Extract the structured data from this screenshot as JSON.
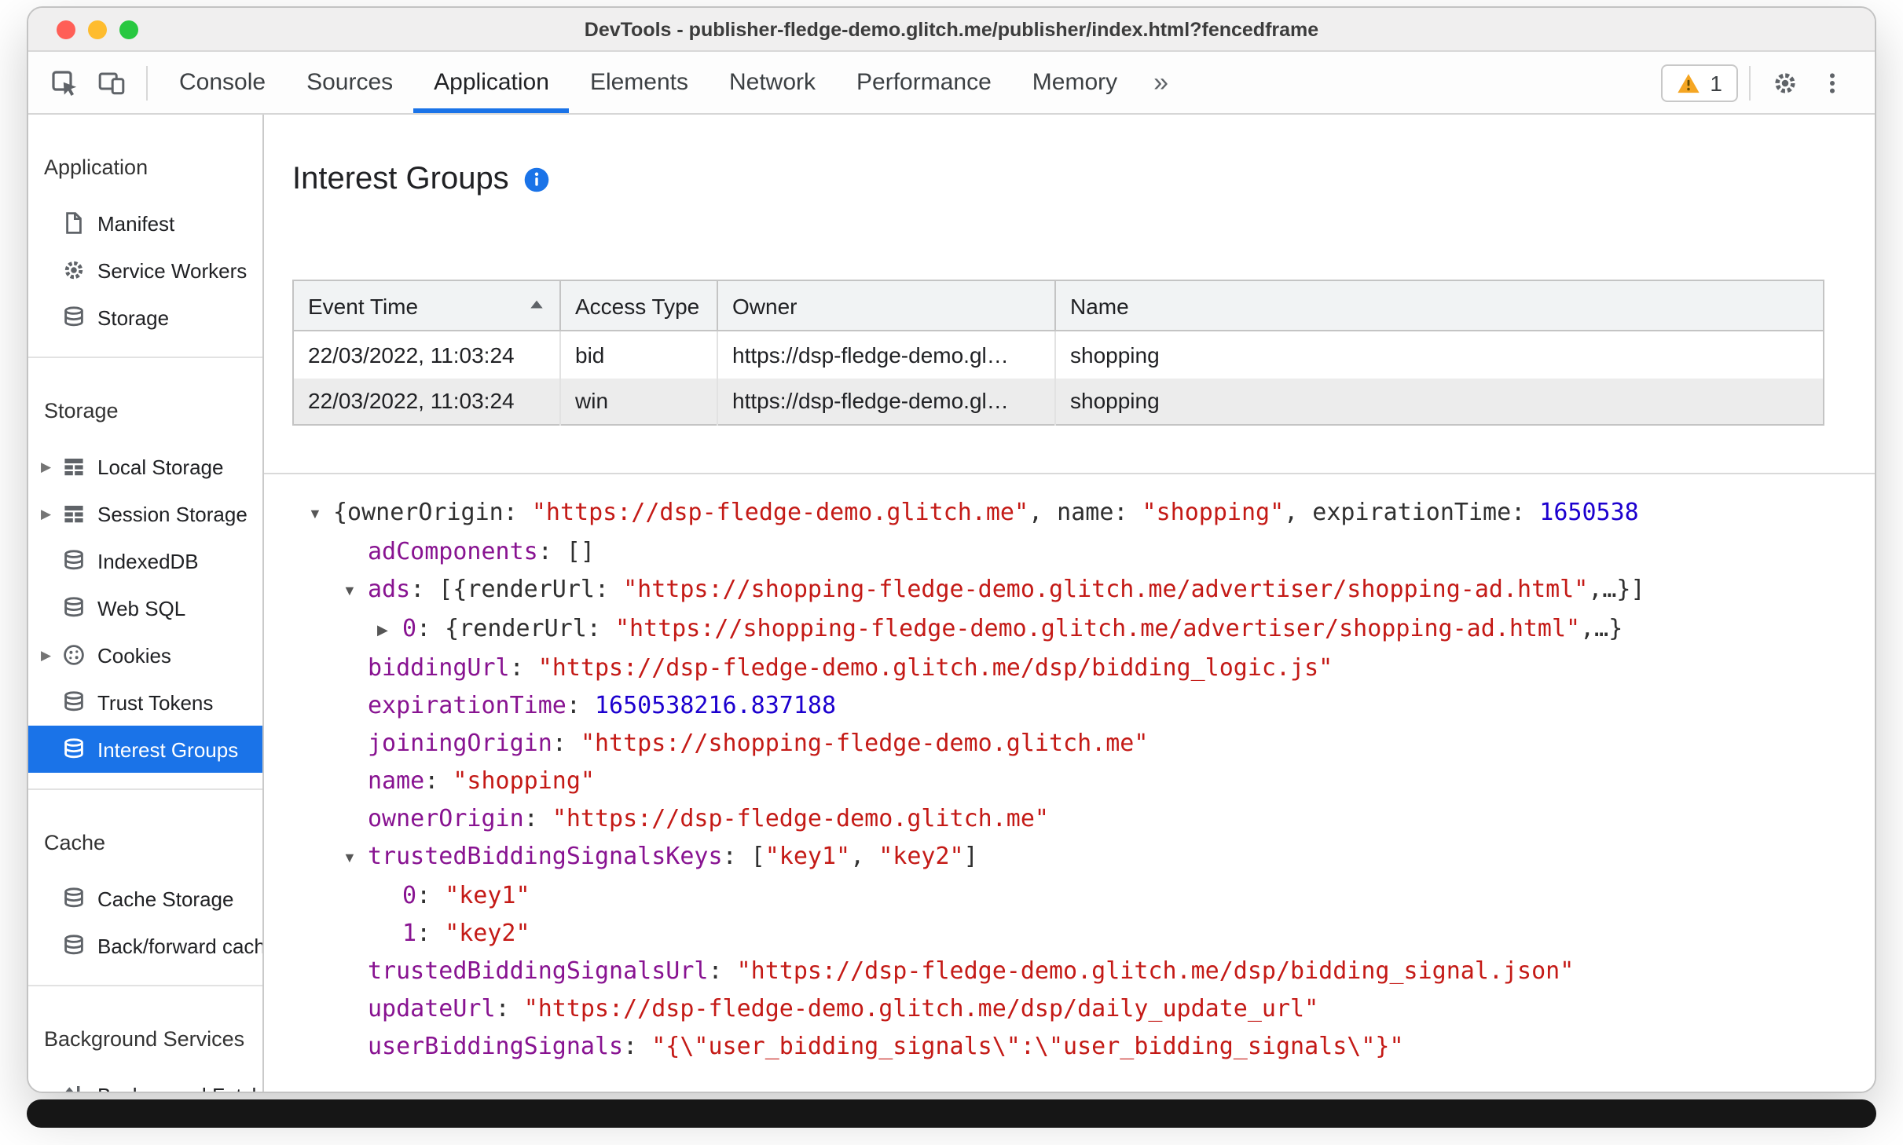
{
  "window": {
    "title": "DevTools - publisher-fledge-demo.glitch.me/publisher/index.html?fencedframe"
  },
  "toolbar": {
    "tabs": [
      {
        "label": "Console",
        "selected": false
      },
      {
        "label": "Sources",
        "selected": false
      },
      {
        "label": "Application",
        "selected": true
      },
      {
        "label": "Elements",
        "selected": false
      },
      {
        "label": "Network",
        "selected": false
      },
      {
        "label": "Performance",
        "selected": false
      },
      {
        "label": "Memory",
        "selected": false
      }
    ],
    "more_tabs_symbol": "»",
    "warning_count": "1"
  },
  "sidebar": {
    "sections": [
      {
        "title": "Application",
        "items": [
          {
            "label": "Manifest",
            "icon": "manifest-file-icon"
          },
          {
            "label": "Service Workers",
            "icon": "service-worker-gear-icon"
          },
          {
            "label": "Storage",
            "icon": "database-icon"
          }
        ]
      },
      {
        "title": "Storage",
        "items": [
          {
            "label": "Local Storage",
            "icon": "table-icon",
            "expandable": true
          },
          {
            "label": "Session Storage",
            "icon": "table-icon",
            "expandable": true
          },
          {
            "label": "IndexedDB",
            "icon": "database-icon"
          },
          {
            "label": "Web SQL",
            "icon": "database-icon"
          },
          {
            "label": "Cookies",
            "icon": "cookie-icon",
            "expandable": true
          },
          {
            "label": "Trust Tokens",
            "icon": "database-icon"
          },
          {
            "label": "Interest Groups",
            "icon": "database-icon",
            "selected": true
          }
        ]
      },
      {
        "title": "Cache",
        "items": [
          {
            "label": "Cache Storage",
            "icon": "database-icon"
          },
          {
            "label": "Back/forward cach",
            "icon": "database-icon"
          }
        ]
      },
      {
        "title": "Background Services",
        "items": [
          {
            "label": "Background Fetch",
            "icon": "background-fetch-icon"
          }
        ]
      }
    ]
  },
  "main": {
    "title": "Interest Groups",
    "table": {
      "columns": [
        "Event Time",
        "Access Type",
        "Owner",
        "Name"
      ],
      "sorted_column": "Event Time",
      "rows": [
        [
          "22/03/2022, 11:03:24",
          "bid",
          "https://dsp-fledge-demo.gl…",
          "shopping"
        ],
        [
          "22/03/2022, 11:03:24",
          "win",
          "https://dsp-fledge-demo.gl…",
          "shopping"
        ]
      ]
    },
    "tree": {
      "lines": [
        {
          "indent": 0,
          "arrow": "down",
          "segments": [
            {
              "t": "{ownerOrigin: ",
              "c": "plain"
            },
            {
              "t": "\"https://dsp-fledge-demo.glitch.me\"",
              "c": "string"
            },
            {
              "t": ", name: ",
              "c": "plain"
            },
            {
              "t": "\"shopping\"",
              "c": "string"
            },
            {
              "t": ", expirationTime: ",
              "c": "plain"
            },
            {
              "t": "1650538",
              "c": "number"
            }
          ]
        },
        {
          "indent": 1,
          "arrow": null,
          "segments": [
            {
              "t": "adComponents",
              "c": "key"
            },
            {
              "t": ": []",
              "c": "plain"
            }
          ]
        },
        {
          "indent": 1,
          "arrow": "down",
          "segments": [
            {
              "t": "ads",
              "c": "key"
            },
            {
              "t": ": [{renderUrl: ",
              "c": "plain"
            },
            {
              "t": "\"https://shopping-fledge-demo.glitch.me/advertiser/shopping-ad.html\"",
              "c": "string"
            },
            {
              "t": ",…}]",
              "c": "plain"
            }
          ]
        },
        {
          "indent": 2,
          "arrow": "right",
          "segments": [
            {
              "t": "0",
              "c": "key"
            },
            {
              "t": ": {renderUrl: ",
              "c": "plain"
            },
            {
              "t": "\"https://shopping-fledge-demo.glitch.me/advertiser/shopping-ad.html\"",
              "c": "string"
            },
            {
              "t": ",…}",
              "c": "plain"
            }
          ]
        },
        {
          "indent": 1,
          "arrow": null,
          "segments": [
            {
              "t": "biddingUrl",
              "c": "key"
            },
            {
              "t": ": ",
              "c": "plain"
            },
            {
              "t": "\"https://dsp-fledge-demo.glitch.me/dsp/bidding_logic.js\"",
              "c": "string"
            }
          ]
        },
        {
          "indent": 1,
          "arrow": null,
          "segments": [
            {
              "t": "expirationTime",
              "c": "key"
            },
            {
              "t": ": ",
              "c": "plain"
            },
            {
              "t": "1650538216.837188",
              "c": "number"
            }
          ]
        },
        {
          "indent": 1,
          "arrow": null,
          "segments": [
            {
              "t": "joiningOrigin",
              "c": "key"
            },
            {
              "t": ": ",
              "c": "plain"
            },
            {
              "t": "\"https://shopping-fledge-demo.glitch.me\"",
              "c": "string"
            }
          ]
        },
        {
          "indent": 1,
          "arrow": null,
          "segments": [
            {
              "t": "name",
              "c": "key"
            },
            {
              "t": ": ",
              "c": "plain"
            },
            {
              "t": "\"shopping\"",
              "c": "string"
            }
          ]
        },
        {
          "indent": 1,
          "arrow": null,
          "segments": [
            {
              "t": "ownerOrigin",
              "c": "key"
            },
            {
              "t": ": ",
              "c": "plain"
            },
            {
              "t": "\"https://dsp-fledge-demo.glitch.me\"",
              "c": "string"
            }
          ]
        },
        {
          "indent": 1,
          "arrow": "down",
          "segments": [
            {
              "t": "trustedBiddingSignalsKeys",
              "c": "key"
            },
            {
              "t": ": [",
              "c": "plain"
            },
            {
              "t": "\"key1\"",
              "c": "string"
            },
            {
              "t": ", ",
              "c": "plain"
            },
            {
              "t": "\"key2\"",
              "c": "string"
            },
            {
              "t": "]",
              "c": "plain"
            }
          ]
        },
        {
          "indent": 2,
          "arrow": null,
          "segments": [
            {
              "t": "0",
              "c": "key"
            },
            {
              "t": ": ",
              "c": "plain"
            },
            {
              "t": "\"key1\"",
              "c": "string"
            }
          ]
        },
        {
          "indent": 2,
          "arrow": null,
          "segments": [
            {
              "t": "1",
              "c": "key"
            },
            {
              "t": ": ",
              "c": "plain"
            },
            {
              "t": "\"key2\"",
              "c": "string"
            }
          ]
        },
        {
          "indent": 1,
          "arrow": null,
          "segments": [
            {
              "t": "trustedBiddingSignalsUrl",
              "c": "key"
            },
            {
              "t": ": ",
              "c": "plain"
            },
            {
              "t": "\"https://dsp-fledge-demo.glitch.me/dsp/bidding_signal.json\"",
              "c": "string"
            }
          ]
        },
        {
          "indent": 1,
          "arrow": null,
          "segments": [
            {
              "t": "updateUrl",
              "c": "key"
            },
            {
              "t": ": ",
              "c": "plain"
            },
            {
              "t": "\"https://dsp-fledge-demo.glitch.me/dsp/daily_update_url\"",
              "c": "string"
            }
          ]
        },
        {
          "indent": 1,
          "arrow": null,
          "segments": [
            {
              "t": "userBiddingSignals",
              "c": "key"
            },
            {
              "t": ": ",
              "c": "plain"
            },
            {
              "t": "\"{\\\"user_bidding_signals\\\":\\\"user_bidding_signals\\\"}\"",
              "c": "string"
            }
          ]
        }
      ]
    }
  },
  "colors": {
    "accent": "#1a73e8",
    "selection_bg": "#1a73e8",
    "key": "#881391",
    "string": "#C41A16",
    "number": "#1C00CF",
    "warning": "#F5A623"
  }
}
